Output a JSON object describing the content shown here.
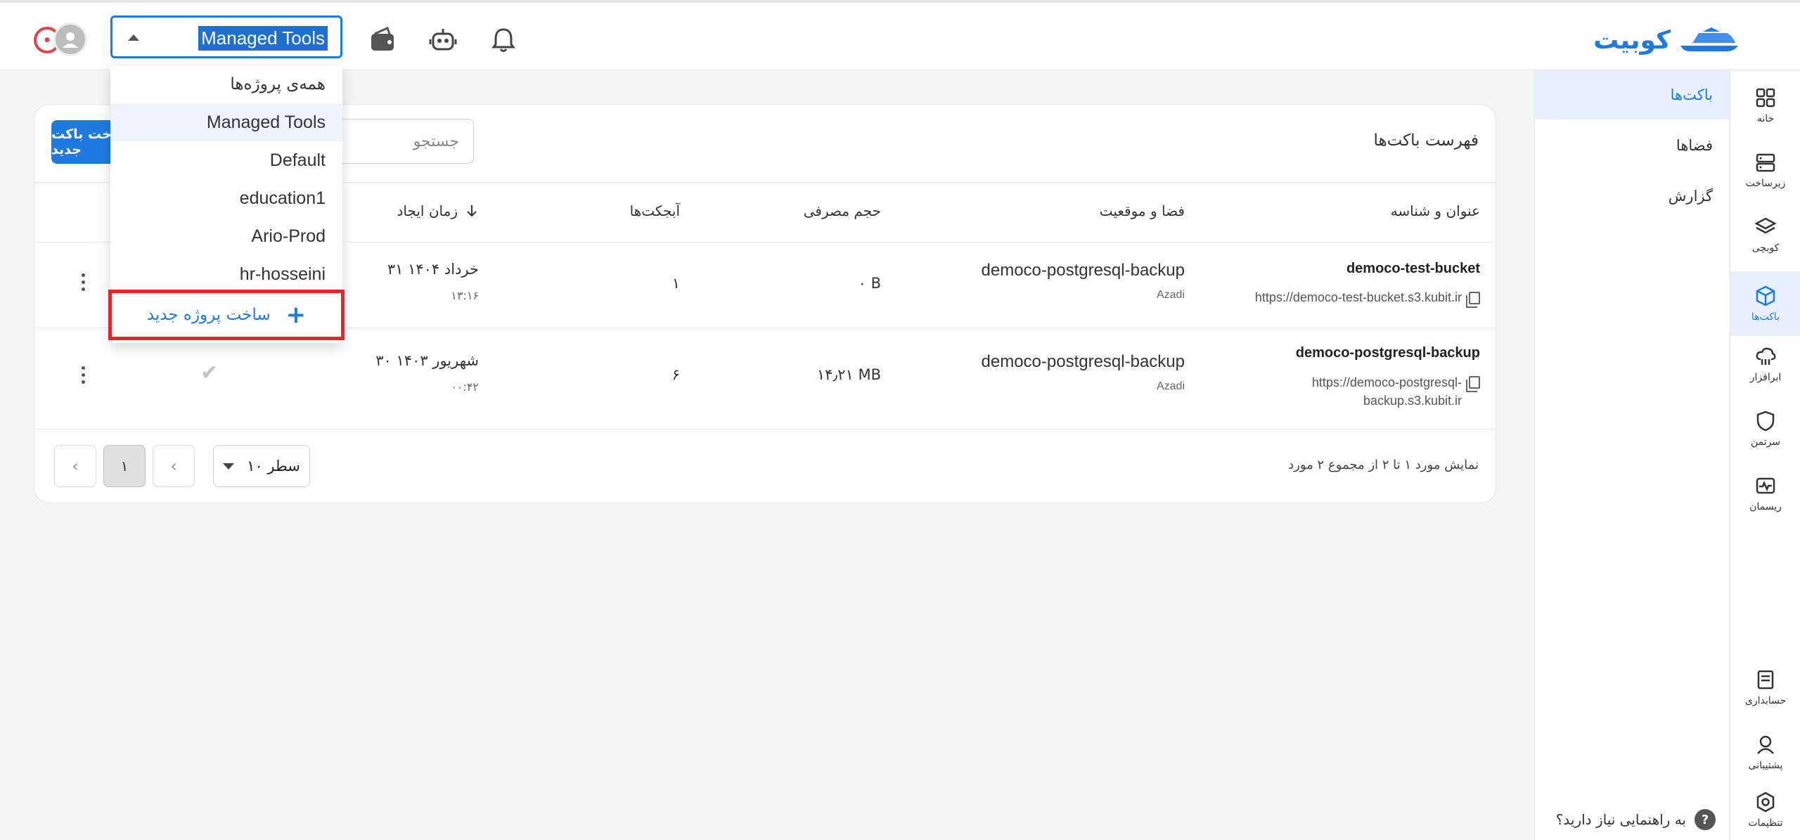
{
  "header": {
    "logo_text": "کوبیت",
    "project_select_value": "Managed Tools",
    "icons": [
      "bell-icon",
      "robot-icon",
      "wallet-icon"
    ]
  },
  "project_dropdown": {
    "items": [
      {
        "label": "همه‌ی پروژه‌ها",
        "selected": false
      },
      {
        "label": "Managed Tools",
        "selected": true
      },
      {
        "label": "Default",
        "selected": false
      },
      {
        "label": "education1",
        "selected": false
      },
      {
        "label": "Ario-Prod",
        "selected": false
      },
      {
        "label": "hr-hosseini",
        "selected": false
      }
    ],
    "create_label": "ساخت پروژه جدید"
  },
  "rail": {
    "items": [
      {
        "label": "خانه",
        "icon": "grid-icon"
      },
      {
        "label": "زیرساخت",
        "icon": "server-icon"
      },
      {
        "label": "کوبچی",
        "icon": "layers-icon"
      },
      {
        "label": "باکت‌ها",
        "icon": "cube-icon",
        "active": true
      },
      {
        "label": "ابرافزار",
        "icon": "cloud-app-icon"
      },
      {
        "label": "سرتمن",
        "icon": "shield-icon"
      },
      {
        "label": "ریسمان",
        "icon": "pulse-icon"
      }
    ],
    "bottom_items": [
      {
        "label": "حسابداری",
        "icon": "billing-icon"
      },
      {
        "label": "پشتیبانی",
        "icon": "support-icon"
      },
      {
        "label": "تنظیمات",
        "icon": "settings-icon"
      }
    ]
  },
  "subnav": {
    "items": [
      {
        "label": "باکت‌ها",
        "active": true
      },
      {
        "label": "فضاها",
        "active": false
      },
      {
        "label": "گزارش",
        "active": false
      }
    ],
    "help_label": "به راهنمایی نیاز دارید؟"
  },
  "card": {
    "title": "فهرست باکت‌ها",
    "search_placeholder": "جستجو",
    "new_button_label": "ساخت باکت جدید",
    "columns": {
      "title": "عنوان و شناسه",
      "space": "فضا و موقعیت",
      "size": "حجم مصرفی",
      "objects": "آبجکت‌ها",
      "created": "زمان ایجاد"
    },
    "rows": [
      {
        "name": "democo-test-bucket",
        "url": "https://democo-test-bucket.s3.kubit.ir",
        "space": "democo-postgresql-backup",
        "location": "Azadi",
        "size": "۰ B",
        "objects": "۱",
        "date": "۳۱ خرداد ۱۴۰۴",
        "time": "۱۳:۱۶",
        "check": ""
      },
      {
        "name": "democo-postgresql-backup",
        "url_line1": "https://democo-postgresql-",
        "url_line2": "backup.s3.kubit.ir",
        "space": "democo-postgresql-backup",
        "location": "Azadi",
        "size": "۱۴٫۲۱ MB",
        "objects": "۶",
        "date": "۳۰ شهریور ۱۴۰۳",
        "time": "۰۰:۴۲",
        "check": "✔"
      }
    ],
    "footer_info": "نمایش مورد ۱ تا ۲ از مجموع ۲ مورد",
    "rows_per_page": "۱۰ سطر",
    "current_page": "۱"
  }
}
